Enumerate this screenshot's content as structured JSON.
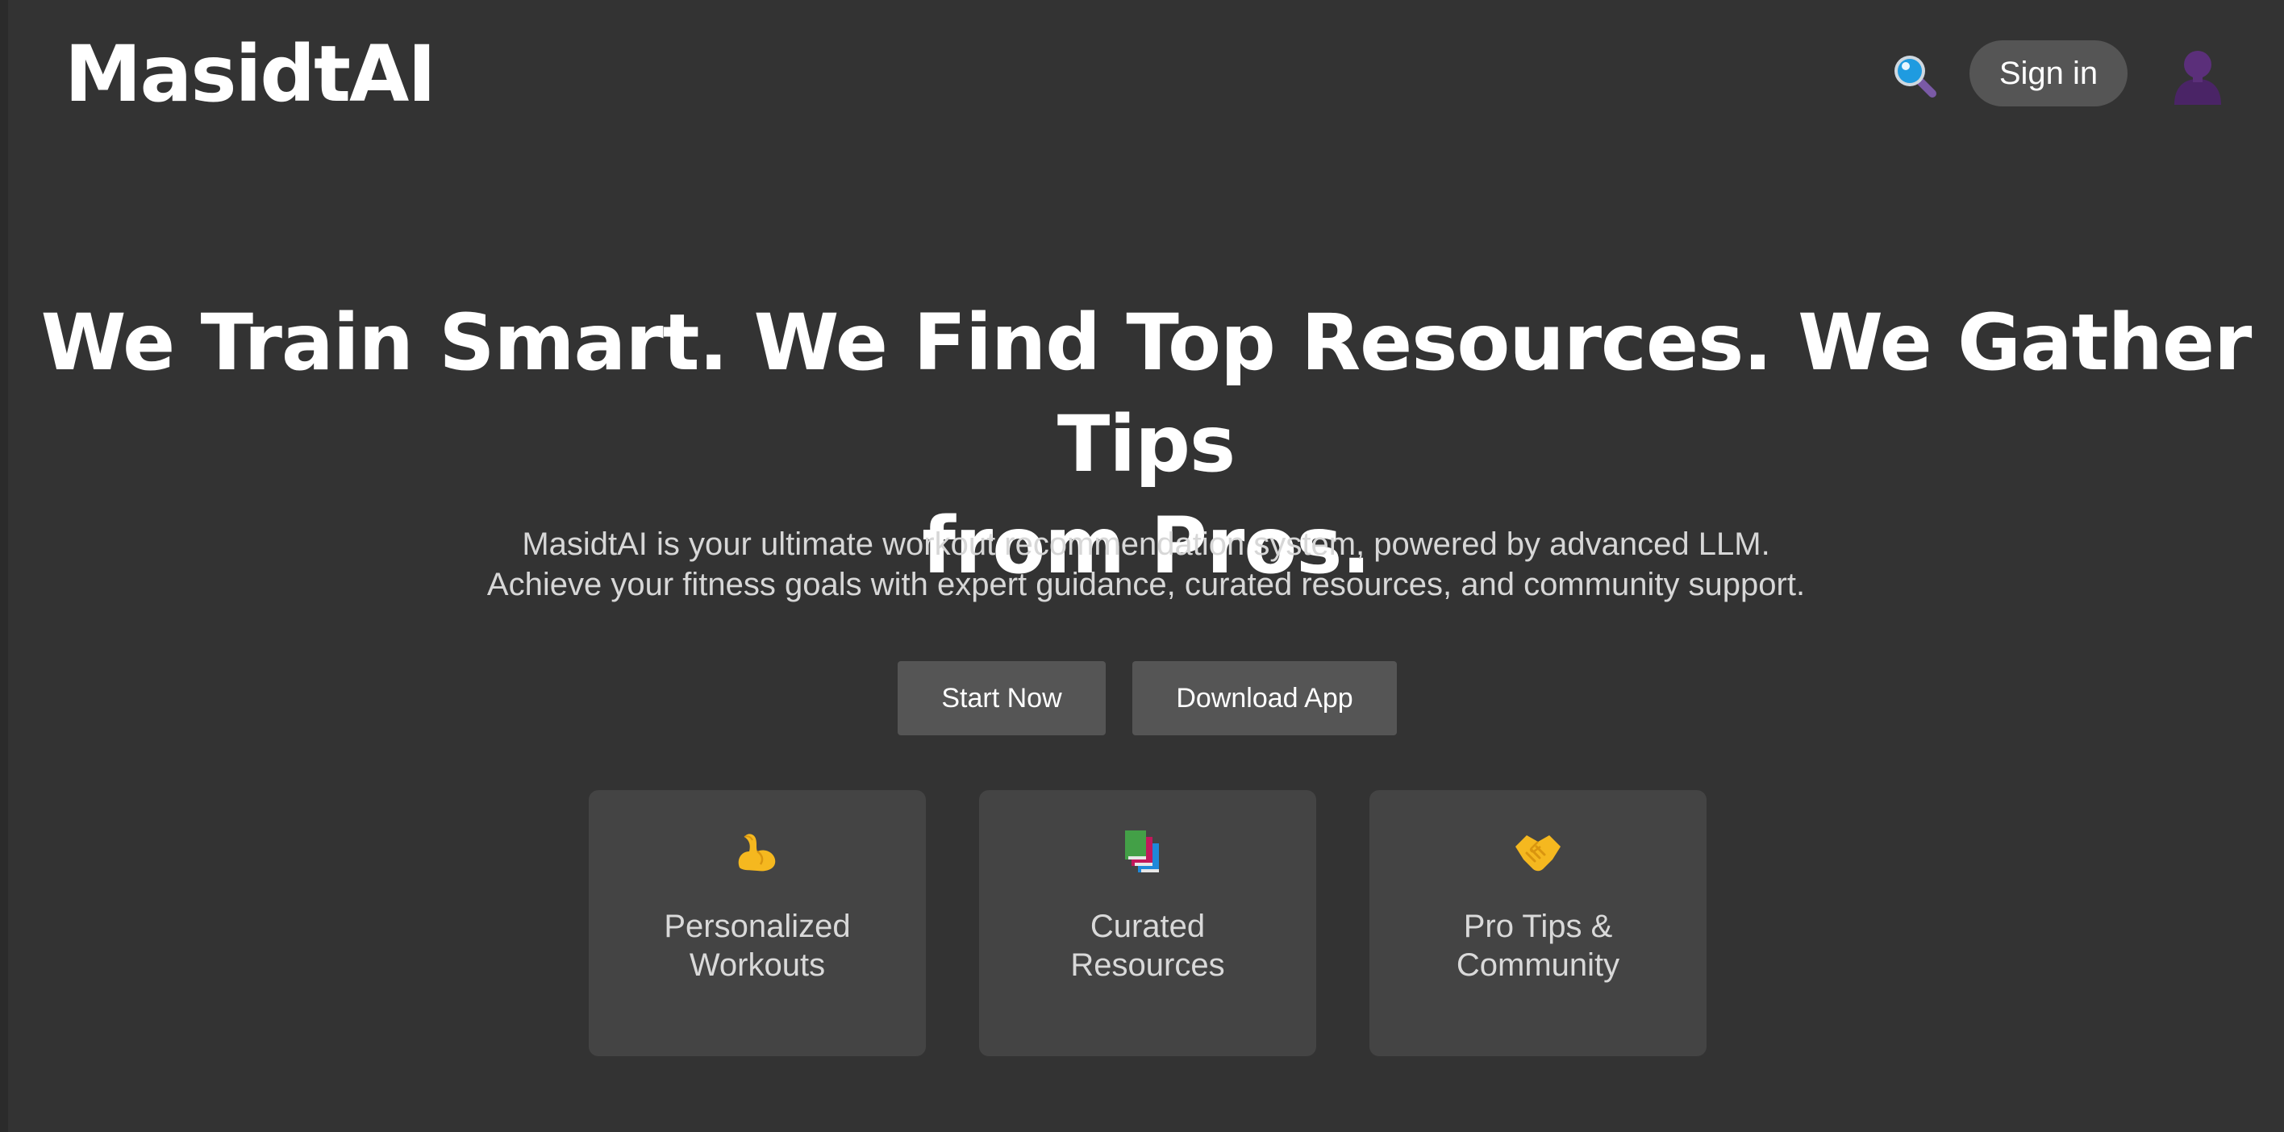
{
  "header": {
    "logo": "MasidtAI",
    "sign_in_label": "Sign in",
    "search_icon": "magnifying-glass-icon",
    "avatar_icon": "user-silhouette-icon"
  },
  "hero": {
    "title_line1": "We Train Smart. We Find Top Resources. We Gather Tips",
    "title_line2": "from Pros.",
    "subtitle_line1": "MasidtAI is your ultimate workout recommendation system, powered by advanced LLM.",
    "subtitle_line2": "Achieve your fitness goals with expert guidance, curated resources, and community support."
  },
  "cta": {
    "start_label": "Start Now",
    "download_label": "Download App"
  },
  "features": [
    {
      "icon": "flexed-biceps-icon",
      "line1": "Personalized",
      "line2": "Workouts"
    },
    {
      "icon": "books-icon",
      "line1": "Curated",
      "line2": "Resources"
    },
    {
      "icon": "handshake-icon",
      "line1": "Pro Tips &",
      "line2": "Community"
    }
  ],
  "colors": {
    "background": "#333333",
    "button": "#555555",
    "card": "#444444",
    "text": "#ffffff"
  }
}
